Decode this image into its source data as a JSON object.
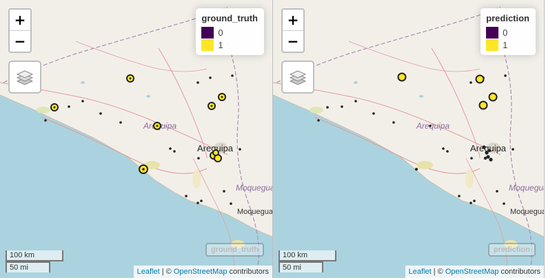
{
  "panels": [
    {
      "id": "left",
      "legend": {
        "title": "ground_truth",
        "items": [
          {
            "label": "0",
            "color": "#440154"
          },
          {
            "label": "1",
            "color": "#fde725"
          }
        ]
      },
      "inset_label": "ground_truth"
    },
    {
      "id": "right",
      "legend": {
        "title": "prediction",
        "items": [
          {
            "label": "0",
            "color": "#440154"
          },
          {
            "label": "1",
            "color": "#fde725"
          }
        ]
      },
      "inset_label": "prediction"
    }
  ],
  "zoom": {
    "in": "+",
    "out": "−"
  },
  "scale": {
    "metric": "100 km",
    "imperial": "50 mi"
  },
  "attribution": {
    "leaflet": "Leaflet",
    "separator": " | © ",
    "osm": "OpenStreetMap",
    "suffix": " contributors"
  },
  "map_labels": {
    "region": "Arequipa",
    "city": "Arequipa",
    "moquegua_region": "Moquegua",
    "moquegua_city": "Moquegua"
  },
  "colors": {
    "sea": "#aad3df",
    "land": "#f2efe9",
    "border": "#a88fb0",
    "road": "#e59a9a",
    "ring": "#222222"
  }
}
